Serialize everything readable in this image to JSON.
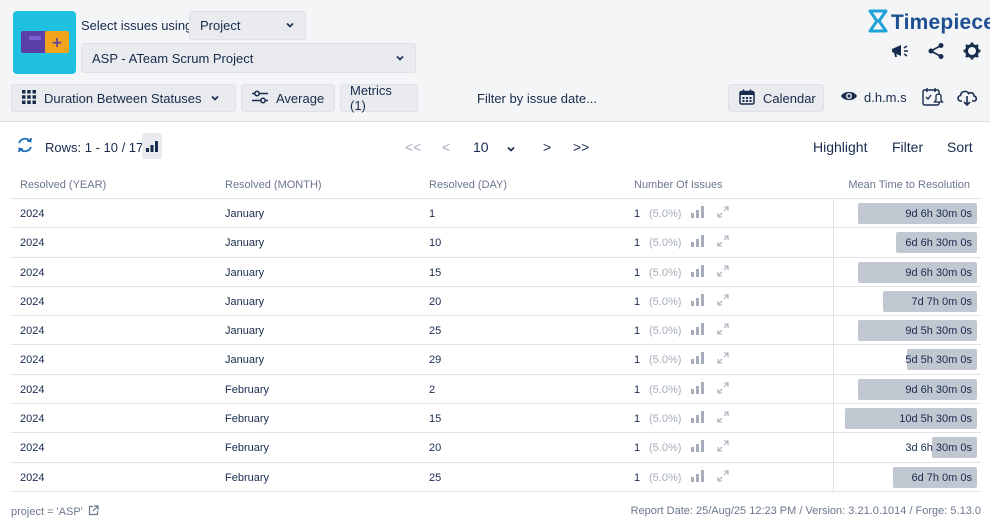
{
  "header": {
    "select_label": "Select issues using",
    "select_by": "Project",
    "project": "ASP - ATeam Scrum Project",
    "brand": "Timepiece",
    "brand_color": "#1d4f91",
    "logo_color": "#1fc0e0"
  },
  "toolbar": {
    "duration_label": "Duration Between Statuses",
    "average_label": "Average",
    "metrics_label": "Metrics (1)",
    "filter_label": "Filter by issue date...",
    "calendar_label": "Calendar",
    "time_format": "d.h.m.s"
  },
  "rows_bar": {
    "rows_text": "Rows: 1 - 10 / 17",
    "page_size": "10",
    "first": "<<",
    "prev": "<",
    "next": ">",
    "last": ">>",
    "highlight": "Highlight",
    "filter": "Filter",
    "sort": "Sort"
  },
  "table": {
    "columns": [
      "Resolved (YEAR)",
      "Resolved (MONTH)",
      "Resolved (DAY)",
      "Number Of Issues",
      "Mean Time to Resolution"
    ],
    "rows": [
      {
        "year": "2024",
        "month": "January",
        "day": "1",
        "count": "1",
        "pct": "(5.0%)",
        "mean": "9d 6h 30m 0s",
        "level": 0.85
      },
      {
        "year": "2024",
        "month": "January",
        "day": "10",
        "count": "1",
        "pct": "(5.0%)",
        "mean": "6d 6h 30m 0s",
        "level": 0.58
      },
      {
        "year": "2024",
        "month": "January",
        "day": "15",
        "count": "1",
        "pct": "(5.0%)",
        "mean": "9d 6h 30m 0s",
        "level": 0.85
      },
      {
        "year": "2024",
        "month": "January",
        "day": "20",
        "count": "1",
        "pct": "(5.0%)",
        "mean": "7d 7h 0m 0s",
        "level": 0.67
      },
      {
        "year": "2024",
        "month": "January",
        "day": "25",
        "count": "1",
        "pct": "(5.0%)",
        "mean": "9d 5h 30m 0s",
        "level": 0.85
      },
      {
        "year": "2024",
        "month": "January",
        "day": "29",
        "count": "1",
        "pct": "(5.0%)",
        "mean": "5d 5h 30m 0s",
        "level": 0.5
      },
      {
        "year": "2024",
        "month": "February",
        "day": "2",
        "count": "1",
        "pct": "(5.0%)",
        "mean": "9d 6h 30m 0s",
        "level": 0.85
      },
      {
        "year": "2024",
        "month": "February",
        "day": "15",
        "count": "1",
        "pct": "(5.0%)",
        "mean": "10d 5h 30m 0s",
        "level": 0.94
      },
      {
        "year": "2024",
        "month": "February",
        "day": "20",
        "count": "1",
        "pct": "(5.0%)",
        "mean": "3d 6h 30m 0s",
        "level": 0.32
      },
      {
        "year": "2024",
        "month": "February",
        "day": "25",
        "count": "1",
        "pct": "(5.0%)",
        "mean": "6d 7h 0m 0s",
        "level": 0.6
      }
    ]
  },
  "footer": {
    "query": "project = 'ASP'",
    "report": "Report Date: 25/Aug/25 12:23 PM / Version: 3.21.0.1014 / Forge: 5.13.0"
  }
}
